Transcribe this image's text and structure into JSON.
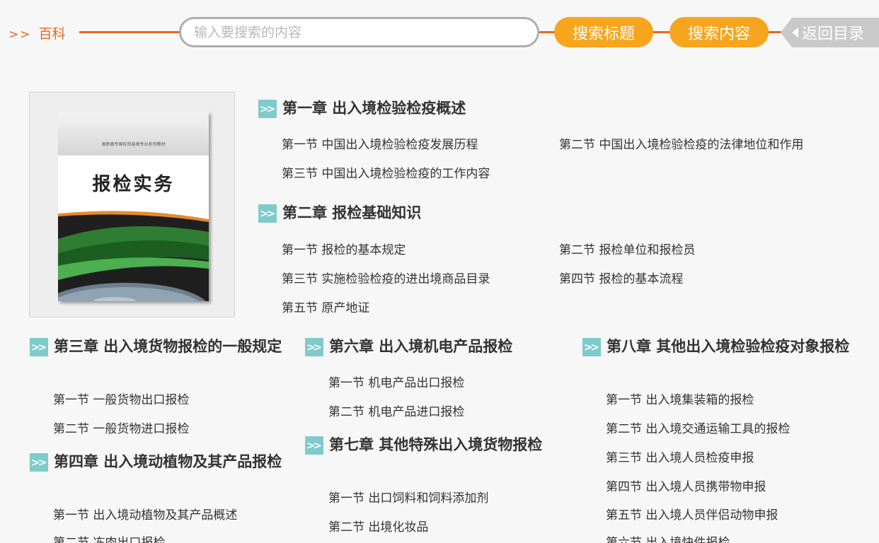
{
  "header": {
    "crumb_arrows": ">>",
    "crumb_label": "百科",
    "search_placeholder": "输入要搜索的内容",
    "btn_search_title": "搜索标题",
    "btn_search_content": "搜索内容",
    "btn_back": "返回目录"
  },
  "book": {
    "subtitle": "高职高专国际贸易类专业系列教材",
    "title": "报检实务"
  },
  "chapters": [
    {
      "title": "第一章  出入境检验检疫概述",
      "sections": [
        "第一节 中国出入境检验检疫发展历程",
        "第二节 中国出入境检验检疫的法律地位和作用",
        "第三节 中国出入境检验检疫的工作内容"
      ]
    },
    {
      "title": "第二章  报检基础知识",
      "sections": [
        "第一节 报检的基本规定",
        "第二节 报检单位和报检员",
        "第三节 实施检验检疫的进出境商品目录",
        "第四节 报检的基本流程",
        "第五节 原产地证"
      ]
    },
    {
      "title": "第三章  出入境货物报检的一般规定",
      "sections": [
        "第一节 一般货物出口报检",
        "第二节 一般货物进口报检"
      ]
    },
    {
      "title": "第四章  出入境动植物及其产品报检",
      "sections": [
        "第一节 出入境动植物及其产品概述",
        "第二节 冻肉出口报检"
      ]
    },
    {
      "title": "第六章  出入境机电产品报检",
      "sections": [
        "第一节 机电产品出口报检",
        "第二节 机电产品进口报检"
      ]
    },
    {
      "title": "第七章  其他特殊出入境货物报检",
      "sections": [
        "第一节 出口饲料和饲料添加剂",
        "第二节 出境化妆品"
      ]
    },
    {
      "title": "第八章  其他出入境检验检疫对象报检",
      "sections": [
        "第一节 出入境集装箱的报检",
        "第二节 出入境交通运输工具的报检",
        "第三节 出入境人员检疫申报",
        "第四节 出入境人员携带物申报",
        "第五节 出入境人员伴侣动物申报",
        "第六节 出入境快件报检"
      ]
    }
  ],
  "colors": {
    "accent_orange": "#e8671b",
    "button_orange": "#f7a51d",
    "back_gray": "#c9c9c9",
    "icon_teal": "#7fcbcb"
  }
}
